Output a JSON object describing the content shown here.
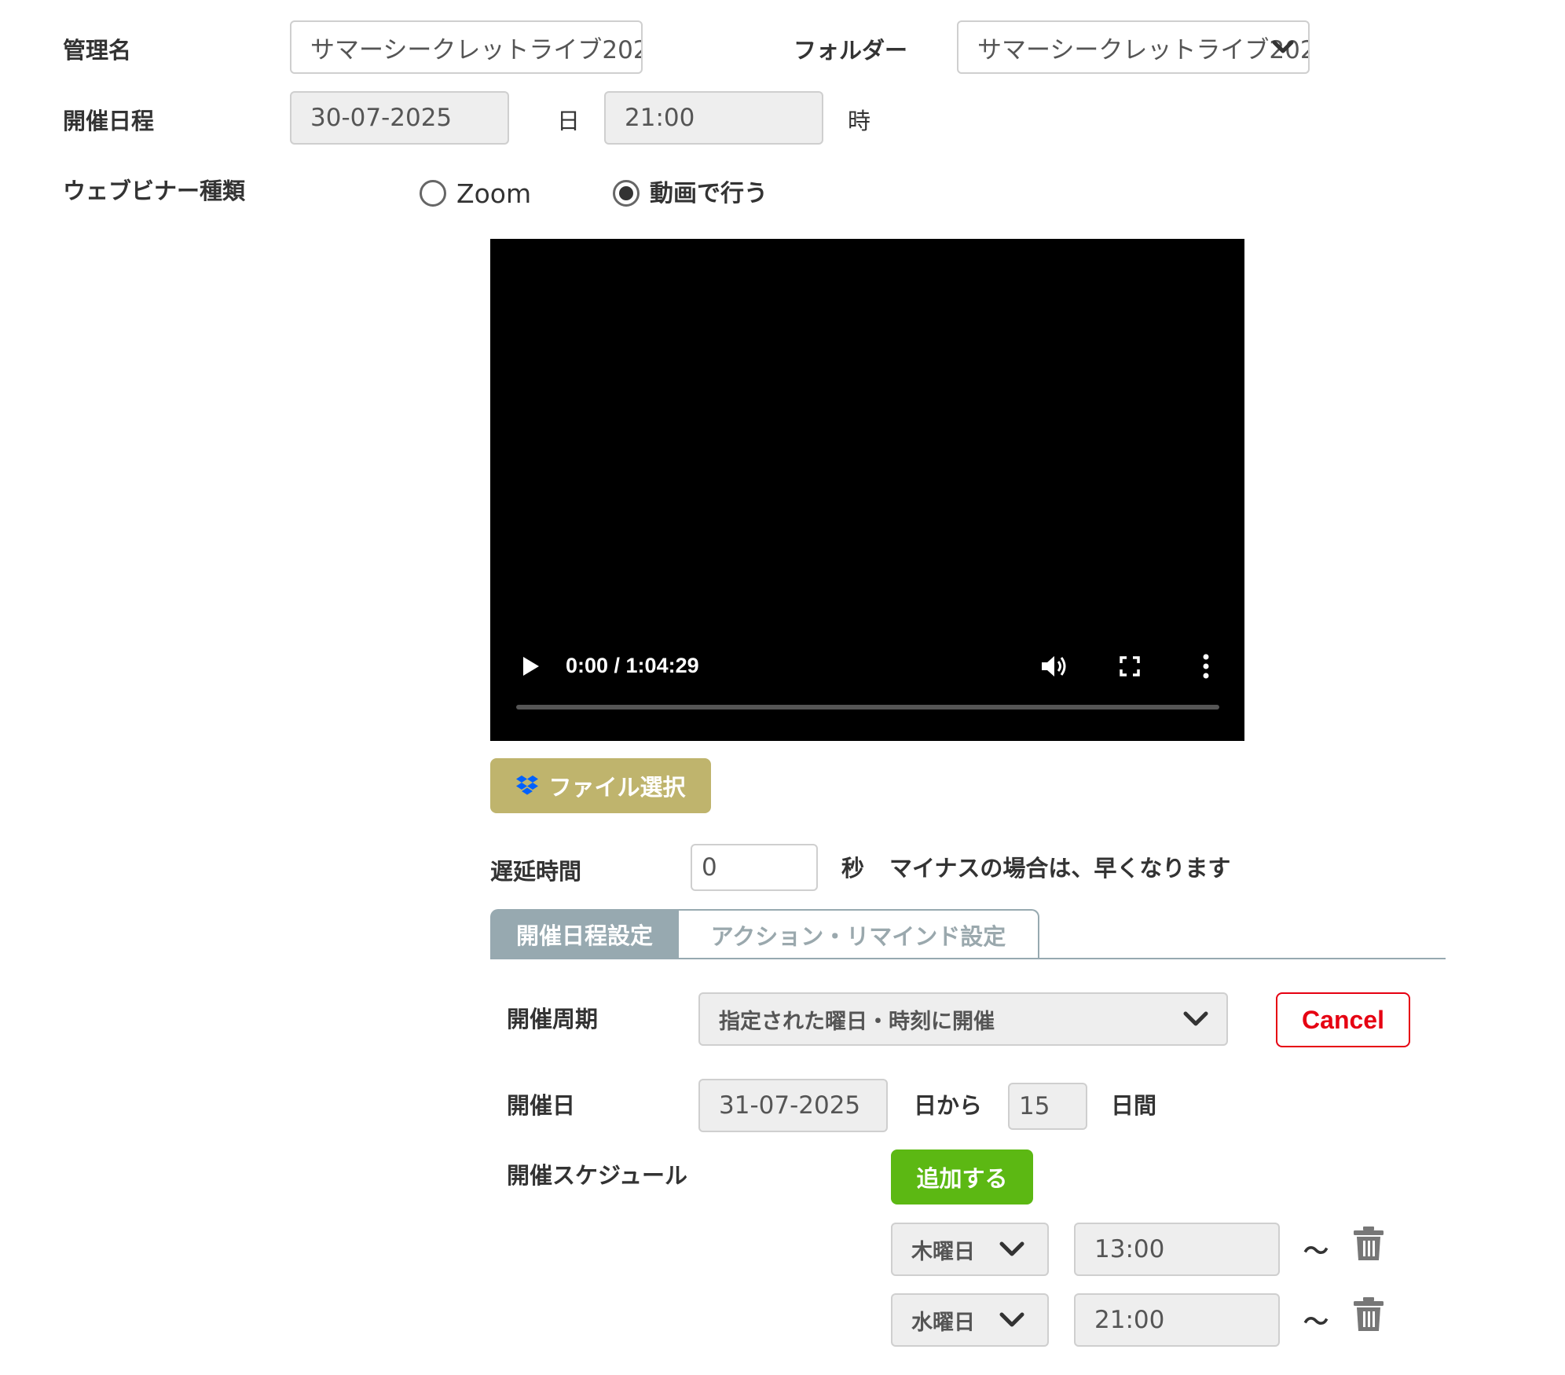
{
  "form": {
    "management_name_label": "管理名",
    "management_name_value": "サマーシークレットライブ202",
    "folder_label": "フォルダー",
    "folder_value": "サマーシークレットライブ202",
    "schedule_label": "開催日程",
    "date_value": "30-07-2025",
    "day_unit": "日",
    "time_value": "21:00",
    "hour_unit": "時",
    "webinar_type_label": "ウェブビナー種類",
    "webinar_options": [
      "Zoom",
      "動画で行う"
    ],
    "webinar_selected": "動画で行う"
  },
  "video": {
    "time_display": "0:00 / 1:04:29",
    "progress": 0
  },
  "file_select_label": "ファイル選択",
  "delay": {
    "label": "遅延時間",
    "value": "0",
    "unit": "秒",
    "hint": "マイナスの場合は、早くなります"
  },
  "tabs": [
    {
      "label": "開催日程設定",
      "active": true
    },
    {
      "label": "アクション・リマインド設定",
      "active": false
    }
  ],
  "schedule_settings": {
    "cycle_label": "開催周期",
    "cycle_value": "指定された曜日・時刻に開催",
    "cancel_label": "Cancel",
    "date_label": "開催日",
    "start_date": "31-07-2025",
    "from_text": "日から",
    "days_value": "15",
    "days_unit": "日間",
    "schedule_label": "開催スケジュール",
    "add_label": "追加する",
    "rows": [
      {
        "day": "木曜日",
        "time": "13:00",
        "tilde": "〜"
      },
      {
        "day": "水曜日",
        "time": "21:00",
        "tilde": "〜"
      }
    ]
  },
  "colors": {
    "accent_gold": "#bfb46d",
    "tab_active": "#97a9b0",
    "add_green": "#5cb813",
    "cancel_red": "#e60012",
    "dropbox_blue": "#0061fe"
  }
}
